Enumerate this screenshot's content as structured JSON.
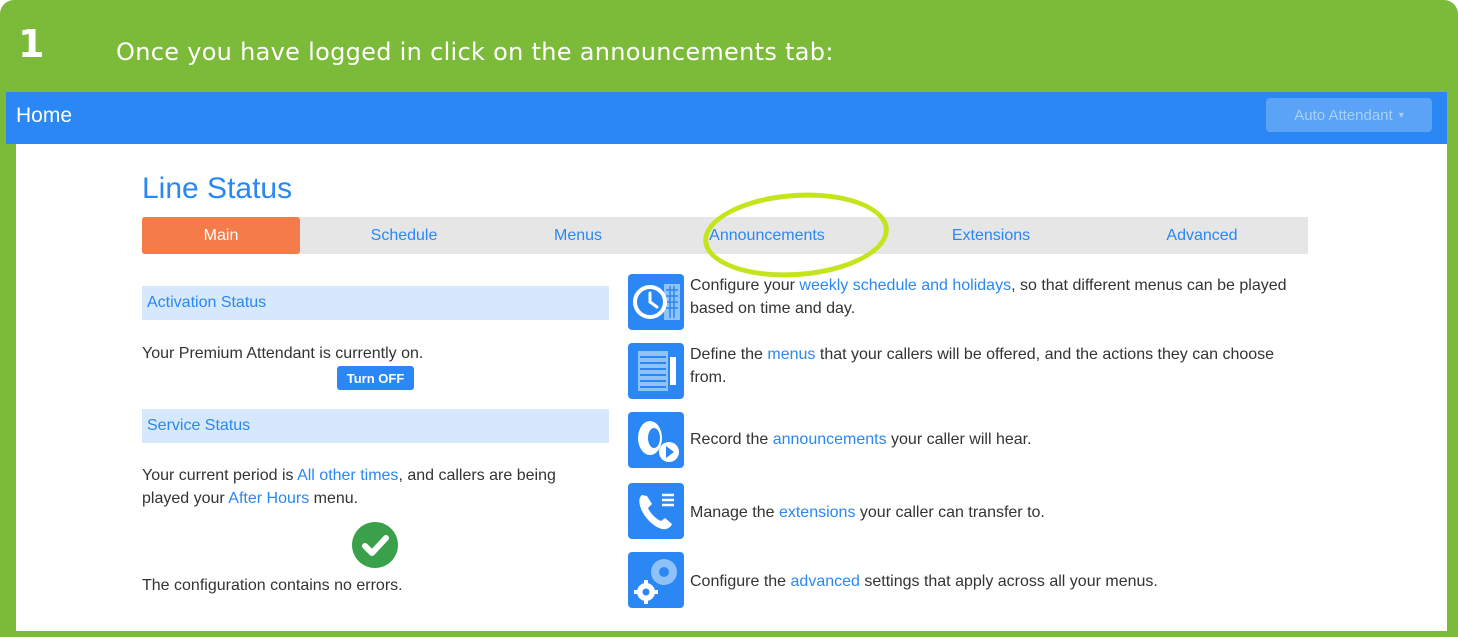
{
  "step": {
    "number": "1",
    "instruction": "Once you have logged in click on the announcements tab:"
  },
  "topbar": {
    "home_label": "Home",
    "mode_dropdown": "Auto Attendant"
  },
  "page": {
    "title": "Line Status"
  },
  "tabs": [
    {
      "label": "Main",
      "active": true
    },
    {
      "label": "Schedule",
      "active": false
    },
    {
      "label": "Menus",
      "active": false
    },
    {
      "label": "Announcements",
      "active": false
    },
    {
      "label": "Extensions",
      "active": false
    },
    {
      "label": "Advanced",
      "active": false
    }
  ],
  "activation": {
    "heading": "Activation Status",
    "text": "Your Premium Attendant is currently on.",
    "button": "Turn OFF"
  },
  "service": {
    "heading": "Service Status",
    "text_before": "Your current period is ",
    "period_link": "All other times",
    "text_middle": ", and callers are being played your ",
    "menu_link": "After Hours",
    "text_after": " menu.",
    "config_text": "The configuration contains no errors."
  },
  "features": [
    {
      "icon": "clock-calendar-icon",
      "before": "Configure your ",
      "link": "weekly schedule and holidays",
      "after": ", so that different menus can be played based on time and day."
    },
    {
      "icon": "menu-list-icon",
      "before": "Define the ",
      "link": "menus",
      "after": " that your callers will be offered, and the actions they can choose from."
    },
    {
      "icon": "speaker-play-icon",
      "before": "Record the ",
      "link": "announcements",
      "after": " your caller will hear."
    },
    {
      "icon": "phone-extensions-icon",
      "before": "Manage the ",
      "link": "extensions",
      "after": " your caller can transfer to."
    },
    {
      "icon": "gears-icon",
      "before": "Configure the ",
      "link": "advanced",
      "after": " settings that apply across all your menus."
    }
  ],
  "colors": {
    "frame_green": "#7cba3a",
    "brand_blue": "#2a87f3",
    "active_tab": "#f47b4a",
    "highlight_ring": "#c4e41c",
    "success_green": "#3aa04a"
  }
}
